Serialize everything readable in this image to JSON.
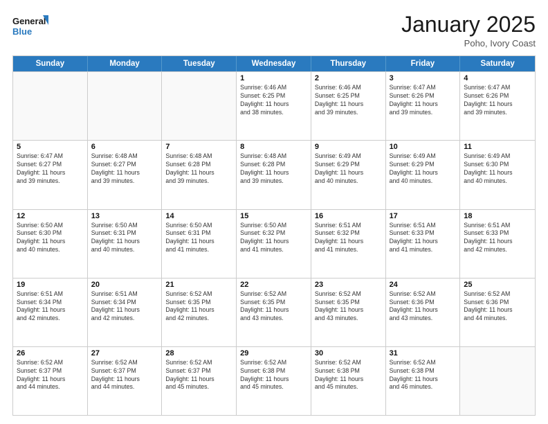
{
  "header": {
    "logo_line1": "General",
    "logo_line2": "Blue",
    "month_title": "January 2025",
    "subtitle": "Poho, Ivory Coast"
  },
  "days_of_week": [
    "Sunday",
    "Monday",
    "Tuesday",
    "Wednesday",
    "Thursday",
    "Friday",
    "Saturday"
  ],
  "weeks": [
    [
      {
        "day": "",
        "info": ""
      },
      {
        "day": "",
        "info": ""
      },
      {
        "day": "",
        "info": ""
      },
      {
        "day": "1",
        "info": "Sunrise: 6:46 AM\nSunset: 6:25 PM\nDaylight: 11 hours\nand 38 minutes."
      },
      {
        "day": "2",
        "info": "Sunrise: 6:46 AM\nSunset: 6:25 PM\nDaylight: 11 hours\nand 39 minutes."
      },
      {
        "day": "3",
        "info": "Sunrise: 6:47 AM\nSunset: 6:26 PM\nDaylight: 11 hours\nand 39 minutes."
      },
      {
        "day": "4",
        "info": "Sunrise: 6:47 AM\nSunset: 6:26 PM\nDaylight: 11 hours\nand 39 minutes."
      }
    ],
    [
      {
        "day": "5",
        "info": "Sunrise: 6:47 AM\nSunset: 6:27 PM\nDaylight: 11 hours\nand 39 minutes."
      },
      {
        "day": "6",
        "info": "Sunrise: 6:48 AM\nSunset: 6:27 PM\nDaylight: 11 hours\nand 39 minutes."
      },
      {
        "day": "7",
        "info": "Sunrise: 6:48 AM\nSunset: 6:28 PM\nDaylight: 11 hours\nand 39 minutes."
      },
      {
        "day": "8",
        "info": "Sunrise: 6:48 AM\nSunset: 6:28 PM\nDaylight: 11 hours\nand 39 minutes."
      },
      {
        "day": "9",
        "info": "Sunrise: 6:49 AM\nSunset: 6:29 PM\nDaylight: 11 hours\nand 40 minutes."
      },
      {
        "day": "10",
        "info": "Sunrise: 6:49 AM\nSunset: 6:29 PM\nDaylight: 11 hours\nand 40 minutes."
      },
      {
        "day": "11",
        "info": "Sunrise: 6:49 AM\nSunset: 6:30 PM\nDaylight: 11 hours\nand 40 minutes."
      }
    ],
    [
      {
        "day": "12",
        "info": "Sunrise: 6:50 AM\nSunset: 6:30 PM\nDaylight: 11 hours\nand 40 minutes."
      },
      {
        "day": "13",
        "info": "Sunrise: 6:50 AM\nSunset: 6:31 PM\nDaylight: 11 hours\nand 40 minutes."
      },
      {
        "day": "14",
        "info": "Sunrise: 6:50 AM\nSunset: 6:31 PM\nDaylight: 11 hours\nand 41 minutes."
      },
      {
        "day": "15",
        "info": "Sunrise: 6:50 AM\nSunset: 6:32 PM\nDaylight: 11 hours\nand 41 minutes."
      },
      {
        "day": "16",
        "info": "Sunrise: 6:51 AM\nSunset: 6:32 PM\nDaylight: 11 hours\nand 41 minutes."
      },
      {
        "day": "17",
        "info": "Sunrise: 6:51 AM\nSunset: 6:33 PM\nDaylight: 11 hours\nand 41 minutes."
      },
      {
        "day": "18",
        "info": "Sunrise: 6:51 AM\nSunset: 6:33 PM\nDaylight: 11 hours\nand 42 minutes."
      }
    ],
    [
      {
        "day": "19",
        "info": "Sunrise: 6:51 AM\nSunset: 6:34 PM\nDaylight: 11 hours\nand 42 minutes."
      },
      {
        "day": "20",
        "info": "Sunrise: 6:51 AM\nSunset: 6:34 PM\nDaylight: 11 hours\nand 42 minutes."
      },
      {
        "day": "21",
        "info": "Sunrise: 6:52 AM\nSunset: 6:35 PM\nDaylight: 11 hours\nand 42 minutes."
      },
      {
        "day": "22",
        "info": "Sunrise: 6:52 AM\nSunset: 6:35 PM\nDaylight: 11 hours\nand 43 minutes."
      },
      {
        "day": "23",
        "info": "Sunrise: 6:52 AM\nSunset: 6:35 PM\nDaylight: 11 hours\nand 43 minutes."
      },
      {
        "day": "24",
        "info": "Sunrise: 6:52 AM\nSunset: 6:36 PM\nDaylight: 11 hours\nand 43 minutes."
      },
      {
        "day": "25",
        "info": "Sunrise: 6:52 AM\nSunset: 6:36 PM\nDaylight: 11 hours\nand 44 minutes."
      }
    ],
    [
      {
        "day": "26",
        "info": "Sunrise: 6:52 AM\nSunset: 6:37 PM\nDaylight: 11 hours\nand 44 minutes."
      },
      {
        "day": "27",
        "info": "Sunrise: 6:52 AM\nSunset: 6:37 PM\nDaylight: 11 hours\nand 44 minutes."
      },
      {
        "day": "28",
        "info": "Sunrise: 6:52 AM\nSunset: 6:37 PM\nDaylight: 11 hours\nand 45 minutes."
      },
      {
        "day": "29",
        "info": "Sunrise: 6:52 AM\nSunset: 6:38 PM\nDaylight: 11 hours\nand 45 minutes."
      },
      {
        "day": "30",
        "info": "Sunrise: 6:52 AM\nSunset: 6:38 PM\nDaylight: 11 hours\nand 45 minutes."
      },
      {
        "day": "31",
        "info": "Sunrise: 6:52 AM\nSunset: 6:38 PM\nDaylight: 11 hours\nand 46 minutes."
      },
      {
        "day": "",
        "info": ""
      }
    ]
  ]
}
